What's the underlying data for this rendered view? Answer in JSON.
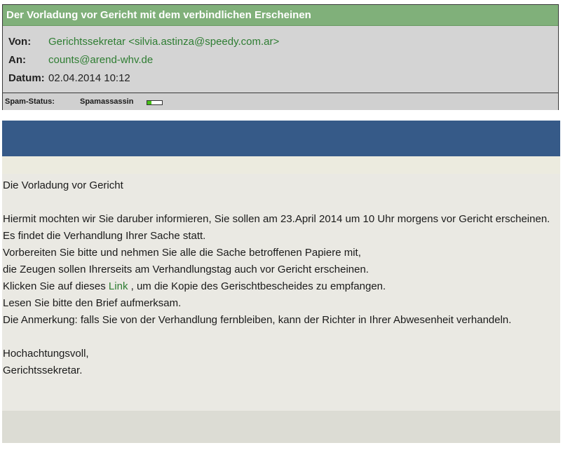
{
  "email": {
    "subject": "Der Vorladung vor Gericht mit dem verbindlichen Erscheinen",
    "from_label": "Von:",
    "from_value": "Gerichtssekretar <silvia.astinza@speedy.com.ar>",
    "to_label": "An:",
    "to_value": "counts@arend-whv.de",
    "date_label": "Datum:",
    "date_value": "02.04.2014 10:12",
    "spam_label": "Spam-Status:",
    "spam_engine": "Spamassassin",
    "spam_level": 0.3,
    "spam_color": "#46c018"
  },
  "message": {
    "line1": "Die Vorladung vor Gericht",
    "line2": "Hiermit mochten wir Sie daruber informieren, Sie sollen am 23.April 2014 um 10 Uhr morgens vor Gericht erscheinen.",
    "line3": "Es findet die Verhandlung Ihrer Sache statt.",
    "line4": "Vorbereiten Sie bitte und nehmen Sie alle die Sache betroffenen Papiere mit,",
    "line5": "die Zeugen sollen Ihrerseits am Verhandlungstag auch vor Gericht erscheinen.",
    "line6_before": "Klicken Sie auf dieses ",
    "line6_link": "Link",
    "line6_after": " , um die Kopie des Gerischtbescheides zu empfangen.",
    "line7": "Lesen Sie bitte den Brief aufmerksam.",
    "line8": "Die Anmerkung: falls Sie von der Verhandlung fernbleiben, kann der Richter in Ihrer Abwesenheit verhandeln.",
    "closing1": "Hochachtungsvoll,",
    "closing2": "Gerichtssekretar."
  },
  "colors": {
    "subject_bar": "#80b07a",
    "banner": "#365a88",
    "link": "#2e7d32"
  }
}
